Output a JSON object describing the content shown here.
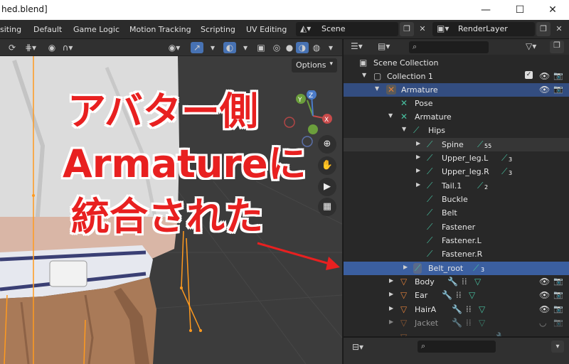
{
  "window": {
    "title": "hed.blend]",
    "minimize": "—",
    "maximize": "☐",
    "close": "✕"
  },
  "workspaces": {
    "tabs": [
      "siting",
      "Default",
      "Game Logic",
      "Motion Tracking",
      "Scripting",
      "UV Editing"
    ],
    "scene_label": "Scene",
    "view_layer_label": "RenderLayer"
  },
  "viewport": {
    "options_label": "Options",
    "overlay_lines": [
      "アバター側",
      "Armatureに",
      "統合された"
    ],
    "gizmo": {
      "x": "X",
      "y": "Y",
      "z": "Z"
    }
  },
  "outliner": {
    "rows": [
      {
        "label": "Scene Collection"
      },
      {
        "label": "Collection 1"
      },
      {
        "label": "Armature"
      },
      {
        "label": "Pose"
      },
      {
        "label": "Armature"
      },
      {
        "label": "Hips"
      },
      {
        "label": "Spine",
        "count": "55"
      },
      {
        "label": "Upper_leg.L",
        "count": "3"
      },
      {
        "label": "Upper_leg.R",
        "count": "3"
      },
      {
        "label": "Tail.1",
        "count": "2"
      },
      {
        "label": "Buckle"
      },
      {
        "label": "Belt"
      },
      {
        "label": "Fastener"
      },
      {
        "label": "Fastener.L"
      },
      {
        "label": "Fastener.R"
      },
      {
        "label": "Belt_root",
        "count": "3"
      },
      {
        "label": "Body"
      },
      {
        "label": "Ear"
      },
      {
        "label": "HairA"
      },
      {
        "label": "Jacket"
      }
    ]
  },
  "colors": {
    "accent_red": "#e82020",
    "selection_blue": "#334d80",
    "bone_green": "#48c0a0",
    "armature_orange": "#e0803a"
  }
}
